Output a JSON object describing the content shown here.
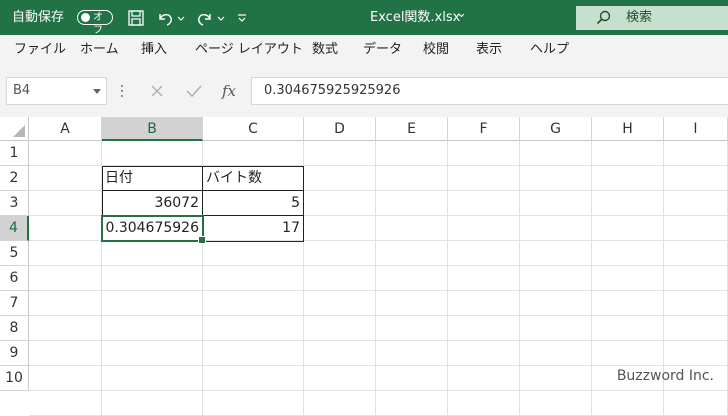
{
  "titlebar": {
    "autosave_label": "自動保存",
    "autosave_state": "オフ",
    "file_name": "Excel関数.xlsx",
    "file_chevron": "⌄",
    "search_placeholder": "検索",
    "accent_color": "#217346"
  },
  "ribbon": {
    "tabs": [
      "ファイル",
      "ホーム",
      "挿入",
      "ページ レイアウト",
      "数式",
      "データ",
      "校閲",
      "表示",
      "ヘルプ"
    ]
  },
  "formula_bar": {
    "name_box": "B4",
    "fx_label": "fx",
    "value": "0.304675925925926"
  },
  "sheet": {
    "columns": [
      "A",
      "B",
      "C",
      "D",
      "E",
      "F",
      "G",
      "H",
      "I"
    ],
    "rows": [
      "1",
      "2",
      "3",
      "4",
      "5",
      "6",
      "7",
      "8",
      "9",
      "10"
    ],
    "cells": {
      "B2": "日付",
      "C2": "バイト数",
      "B3": "36072",
      "C3": "5",
      "B4": "0.304675926",
      "C4": "17"
    },
    "active_cell": "B4"
  },
  "watermark": "Buzzword Inc."
}
